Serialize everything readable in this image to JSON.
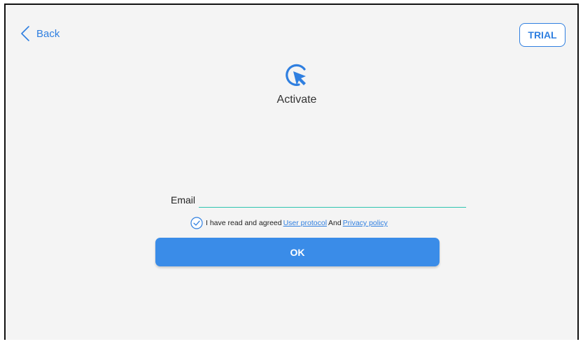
{
  "header": {
    "back_label": "Back",
    "trial_label": "TRIAL"
  },
  "main": {
    "title": "Activate",
    "logo_icon": "cursor-click-icon",
    "email": {
      "label": "Email",
      "value": "",
      "placeholder": ""
    },
    "agreement": {
      "checked": true,
      "prefix": "I have read and agreed",
      "user_protocol": "User protocol",
      "conjunction": "And",
      "privacy_policy": "Privacy policy"
    },
    "ok_label": "OK"
  },
  "colors": {
    "accent": "#2f7fe0",
    "button": "#3a8ce8",
    "input_underline": "#2ec4b0",
    "background": "#f4f4f4"
  }
}
